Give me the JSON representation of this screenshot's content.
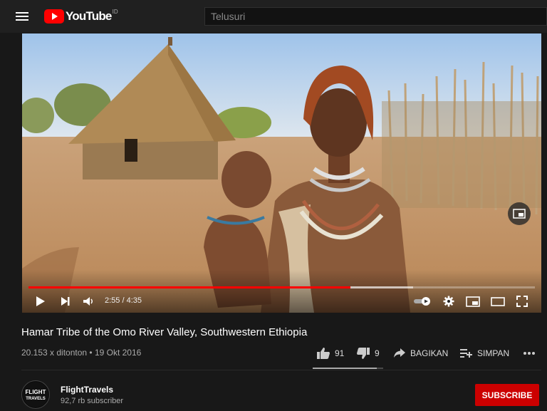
{
  "header": {
    "logo_text": "YouTube",
    "logo_region": "ID",
    "search_placeholder": "Telusuri"
  },
  "player": {
    "current_time": "2:55",
    "duration": "4:35",
    "time_display": "2:55 / 4:35",
    "played_fraction": 0.636,
    "buffered_fraction": 0.76
  },
  "video": {
    "title": "Hamar Tribe of the Omo River Valley, Southwestern Ethiopia",
    "views_date": "20.153 x ditonton • 19 Okt 2016",
    "likes": "91",
    "dislikes": "9",
    "share_label": "BAGIKAN",
    "save_label": "SIMPAN",
    "like_ratio": 0.91
  },
  "channel": {
    "name": "FlightTravels",
    "subscribers": "92,7 rb subscriber",
    "avatar_text_1": "FLIGHT",
    "avatar_text_2": "TRAVELS",
    "subscribe_label": "SUBSCRIBE"
  },
  "colors": {
    "brand_red": "#ff0000",
    "subscribe_red": "#cc0000",
    "background": "#181818"
  }
}
